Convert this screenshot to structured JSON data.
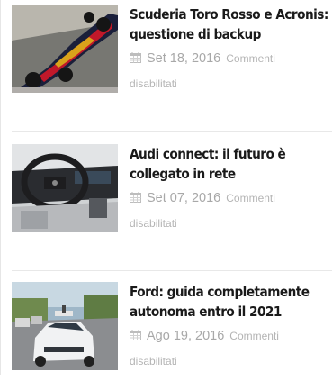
{
  "posts": [
    {
      "title": "Scuderia Toro Rosso e Acronis: questione di backup",
      "date": "Set 18, 2016",
      "comments_line1": "Commenti",
      "comments_line2": "disabilitati",
      "icon": "calendar-icon",
      "thumbnail": "race-car-image"
    },
    {
      "title": "Audi connect: il futuro è collegato in rete",
      "date": "Set 07, 2016",
      "comments_line1": "Commenti",
      "comments_line2": "disabilitati",
      "icon": "calendar-icon",
      "thumbnail": "car-interior-image"
    },
    {
      "title": "Ford: guida completamente autonoma entro il 2021",
      "date": "Ago 19, 2016",
      "comments_line1": "Commenti",
      "comments_line2": "disabilitati",
      "icon": "calendar-icon",
      "thumbnail": "autonomous-car-image"
    }
  ]
}
